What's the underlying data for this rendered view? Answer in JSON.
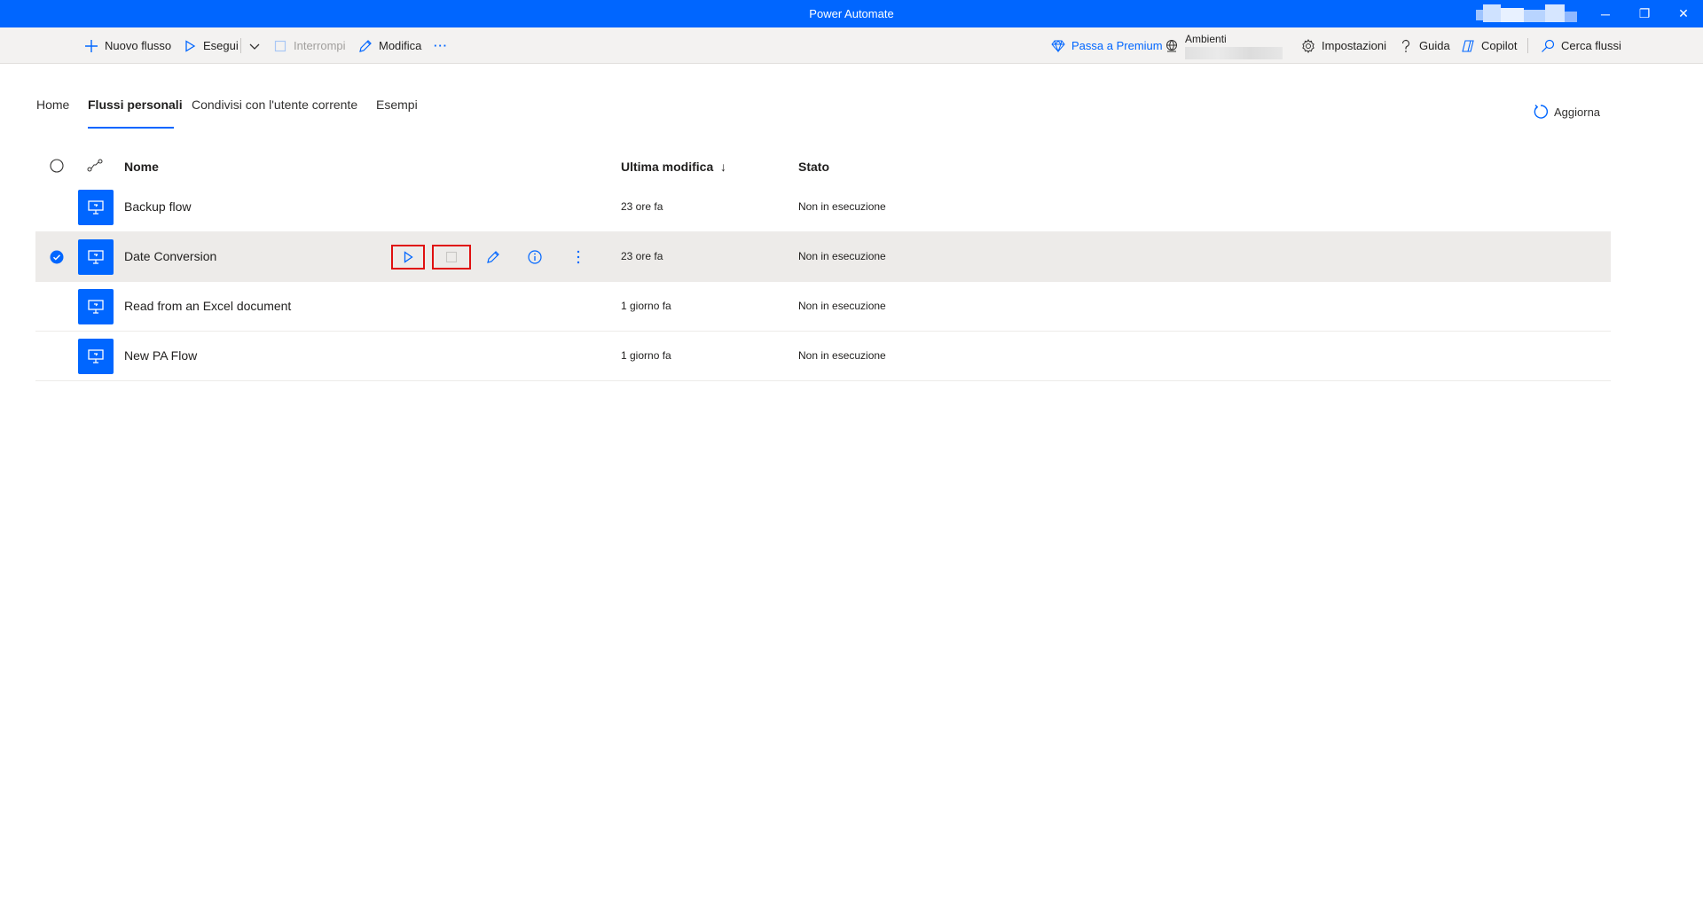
{
  "window": {
    "title": "Power Automate",
    "minimize_glyph": "─",
    "restore_glyph": "❐",
    "close_glyph": "✕"
  },
  "colors": {
    "accent": "#0066ff",
    "selected_row": "#edebe9",
    "highlight_box": "#e01010"
  },
  "toolbar": {
    "new_flow": "Nuovo flusso",
    "run": "Esegui",
    "stop": "Interrompi",
    "edit": "Modifica",
    "more": "···",
    "premium": "Passa a Premium",
    "environments": "Ambienti",
    "settings": "Impostazioni",
    "help": "Guida",
    "copilot": "Copilot",
    "search_placeholder": "Cerca flussi"
  },
  "tabs": [
    {
      "label": "Home"
    },
    {
      "label": "Flussi personali",
      "active": true
    },
    {
      "label": "Condivisi con l'utente corrente"
    },
    {
      "label": "Esempi"
    }
  ],
  "refresh_label": "Aggiorna",
  "table": {
    "headers": {
      "name": "Nome",
      "modified": "Ultima modifica",
      "sort_arrow": "↓",
      "state": "Stato"
    },
    "rows": [
      {
        "name": "Backup flow",
        "modified": "23 ore fa",
        "state": "Non in esecuzione",
        "selected": false
      },
      {
        "name": "Date Conversion",
        "modified": "23 ore fa",
        "state": "Non in esecuzione",
        "selected": true
      },
      {
        "name": "Read from an Excel document",
        "modified": "1 giorno fa",
        "state": "Non in esecuzione",
        "selected": false
      },
      {
        "name": "New PA Flow",
        "modified": "1 giorno fa",
        "state": "Non in esecuzione",
        "selected": false
      }
    ]
  }
}
